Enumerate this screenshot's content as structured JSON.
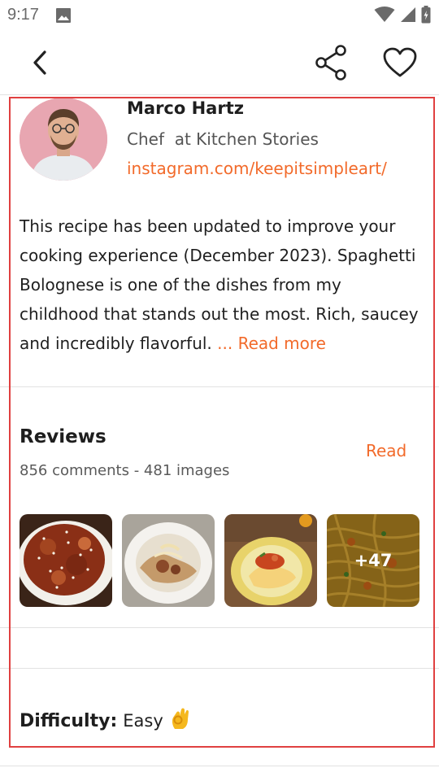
{
  "status_bar": {
    "time": "9:17"
  },
  "author": {
    "name": "Marco Hartz",
    "role": "Chef  at Kitchen Stories",
    "link": "instagram.com/keepitsimpleart/"
  },
  "description": {
    "text": "This recipe has been updated to improve your cooking experience (December 2023). Spaghetti Bolognese is one of the dishes from my childhood that stands out the most. Rich, saucey and incredibly flavorful.",
    "read_more": "... Read more"
  },
  "reviews": {
    "title": "Reviews",
    "meta": "856 comments - 481 images",
    "read_label": "Read",
    "more_count": "+47"
  },
  "difficulty": {
    "label": "Difficulty:",
    "value": "Easy"
  },
  "colors": {
    "accent": "#f26a2a",
    "highlight_border": "#e04040",
    "avatar_bg": "#e8a6b1"
  },
  "icons": {
    "status": [
      "image-icon",
      "wifi-icon",
      "signal-icon",
      "battery-icon"
    ],
    "app_bar": [
      "back-arrow-icon",
      "share-icon",
      "heart-icon"
    ],
    "difficulty": "ok-hand-icon"
  }
}
